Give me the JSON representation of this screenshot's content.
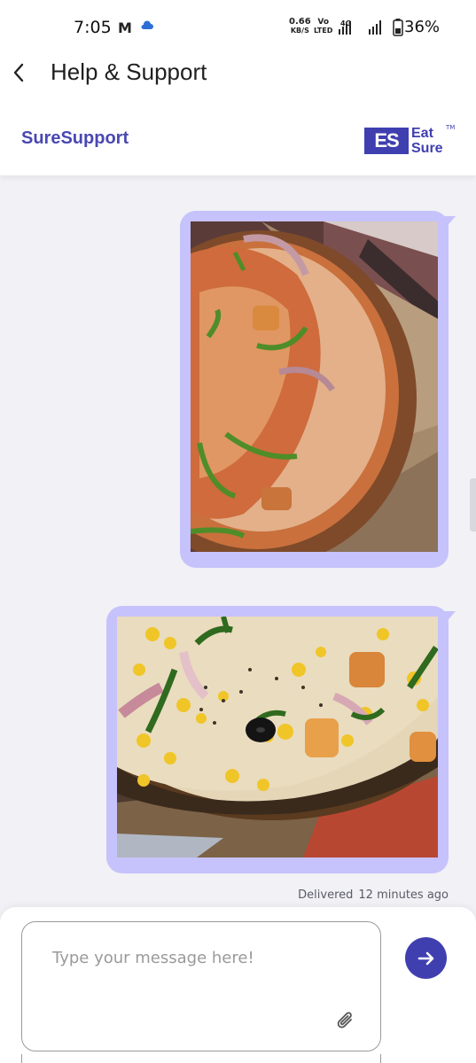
{
  "status_bar": {
    "time": "7:05",
    "speed_value": "0.66",
    "speed_unit": "KB/S",
    "volte_top": "Vo",
    "volte_bottom": "LTED",
    "network": "4G",
    "battery": "36%",
    "icons": [
      "gmail-icon",
      "cloud-icon",
      "signal-icon",
      "battery-icon"
    ]
  },
  "header": {
    "title": "Help & Support",
    "back_icon": "chevron-left-icon"
  },
  "brand": {
    "name": "SureSupport",
    "logo_mark": "ES",
    "logo_word_1": "Eat",
    "logo_word_2": "Sure",
    "logo_tm": "TM",
    "accent_color": "#3f3fb0"
  },
  "messages": [
    {
      "type": "image",
      "subject": "pizza-photo"
    },
    {
      "type": "image",
      "subject": "pizza-photo"
    }
  ],
  "delivery": {
    "status": "Delivered",
    "time": "12 minutes ago"
  },
  "composer": {
    "placeholder": "Type your message here!",
    "value": "",
    "attach_icon": "paperclip-icon",
    "send_icon": "arrow-right-icon"
  },
  "colors": {
    "bubble": "#c6c2fb",
    "background": "#f1f1f6",
    "brand_text": "#4a48b2"
  }
}
